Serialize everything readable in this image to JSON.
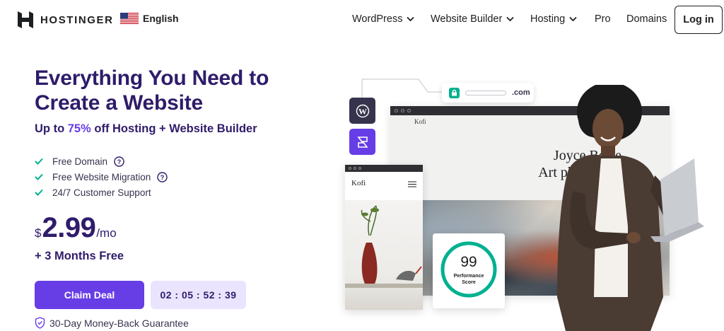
{
  "nav": {
    "brand": "HOSTINGER",
    "language": "English",
    "menu": [
      {
        "label": "WordPress",
        "has_dropdown": true
      },
      {
        "label": "Website Builder",
        "has_dropdown": true
      },
      {
        "label": "Hosting",
        "has_dropdown": true
      },
      {
        "label": "Pro",
        "has_dropdown": false
      },
      {
        "label": "Domains",
        "has_dropdown": false
      }
    ],
    "login_label": "Log in"
  },
  "hero": {
    "headline": "Everything You Need to Create a Website",
    "subhead_prefix": "Up to ",
    "subhead_percent": "75%",
    "subhead_suffix": " off Hosting + Website Builder",
    "features": [
      {
        "label": "Free Domain",
        "has_help": true
      },
      {
        "label": "Free Website Migration",
        "has_help": true
      },
      {
        "label": "24/7 Customer Support",
        "has_help": false
      }
    ],
    "price": {
      "currency": "$",
      "amount": "2.99",
      "period": "/mo"
    },
    "bonus": "+ 3 Months Free",
    "cta_label": "Claim Deal",
    "countdown": "02 : 05 : 52 : 39",
    "guarantee": "30-Day Money-Back Guarantee"
  },
  "illustration": {
    "url_suffix": ".com",
    "desktop_site_logo": "Kofi",
    "desktop_site_title_line1": "Joyce Beale,",
    "desktop_site_title_line2": "Art photograph",
    "mobile_site_logo": "Kofi",
    "performance_score": "99",
    "performance_label_line1": "Performance",
    "performance_label_line2": "Score"
  },
  "colors": {
    "brand_purple": "#673de6",
    "heading_navy": "#2f1c6a",
    "check_green": "#00b090",
    "timer_bg": "#ebe4ff"
  },
  "icons": [
    "hostinger-logo-icon",
    "us-flag-icon",
    "chevron-down-icon",
    "check-icon",
    "help-icon",
    "shield-check-icon",
    "wordpress-icon",
    "website-builder-icon",
    "lock-icon",
    "hamburger-menu-icon"
  ]
}
